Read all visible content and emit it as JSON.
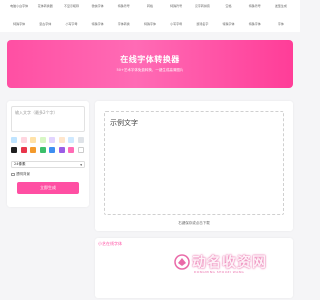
{
  "nav": {
    "items": [
      "电脑小白字体",
      "花体转换器",
      "不显示昵称",
      "微信字体",
      "特殊符号",
      "转格",
      "特殊符号",
      "汉字转拼音",
      "空格",
      "特殊符号",
      "发型生成",
      "特殊字体",
      "复古字体",
      "小写字母",
      "特殊字体",
      "字体转换",
      "特殊字体",
      "小写字母",
      "游戏名字",
      "特殊字体",
      "特殊字体",
      "字体"
    ]
  },
  "hero": {
    "title": "在线字体转换器",
    "subtitle": "50+艺术字体免费转换，一键生成高清图片"
  },
  "editor": {
    "placeholder": "输入文字（最多2个字）",
    "colors": [
      "#bfe4ff",
      "#ffd6e0",
      "#ffe2a8",
      "#d7f7c4",
      "#e2d4ff",
      "#ffe6cc",
      "#cfe9ff",
      "#dfe3e8",
      "#1f1f1f",
      "#e8354b",
      "#f39a2c",
      "#3bbf6a",
      "#3d8ef0",
      "#9b5de5",
      "#ff6bb5",
      "#ffffff"
    ],
    "size_value": "24像素",
    "bg_label": "透明背景",
    "generate_label": "立即生成"
  },
  "preview": {
    "sample_text": "示例文字",
    "hint": "右键保存或点击下载"
  },
  "bottom": {
    "link_text": "小艺在线字体"
  },
  "watermark": {
    "text": "动名收资网",
    "sub": "DONGMING SHOUZI WANG",
    "color": "#e96aa8"
  }
}
